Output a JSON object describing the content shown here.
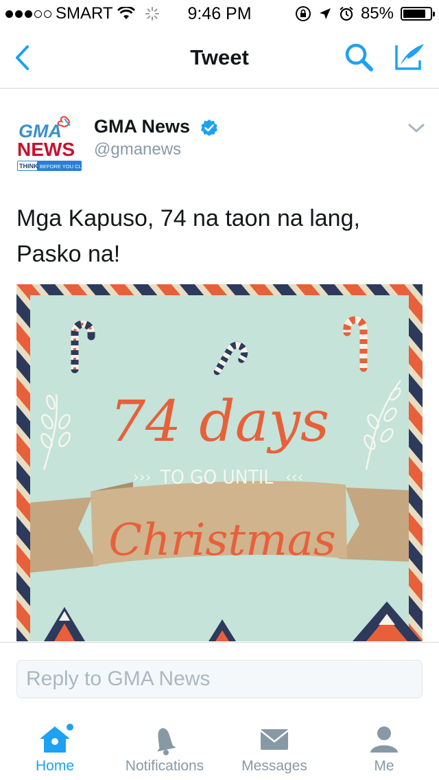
{
  "status_bar": {
    "carrier": "SMART",
    "time": "9:46 PM",
    "battery_percent": "85%",
    "battery_level": 0.85
  },
  "nav": {
    "title": "Tweet",
    "back_icon": "chevron-left-icon",
    "search_icon": "search-icon",
    "compose_icon": "compose-icon"
  },
  "author": {
    "name": "GMA News",
    "handle": "@gmanews",
    "verified": true,
    "avatar_text": {
      "line1": "GMA",
      "line2": "NEWS",
      "tagline_a": "THINK",
      "tagline_b": "BEFORE YOU CLICK"
    }
  },
  "tweet": {
    "text": "Mga Kapuso, 74 na taon na lang, Pasko na!"
  },
  "media": {
    "headline": "74 days",
    "subline": "TO GO UNTIL",
    "banner_text": "Christmas",
    "background": "#c5e3d8",
    "accent_orange": "#e8603a",
    "accent_navy": "#2d3a5c",
    "banner_color": "#cfb48e"
  },
  "reply": {
    "placeholder": "Reply to GMA News"
  },
  "tabs": [
    {
      "label": "Home",
      "icon": "home-icon",
      "active": true
    },
    {
      "label": "Notifications",
      "icon": "bell-icon",
      "active": false
    },
    {
      "label": "Messages",
      "icon": "envelope-icon",
      "active": false
    },
    {
      "label": "Me",
      "icon": "person-icon",
      "active": false
    }
  ],
  "colors": {
    "accent": "#1da1f2",
    "inactive": "#8899a6"
  }
}
